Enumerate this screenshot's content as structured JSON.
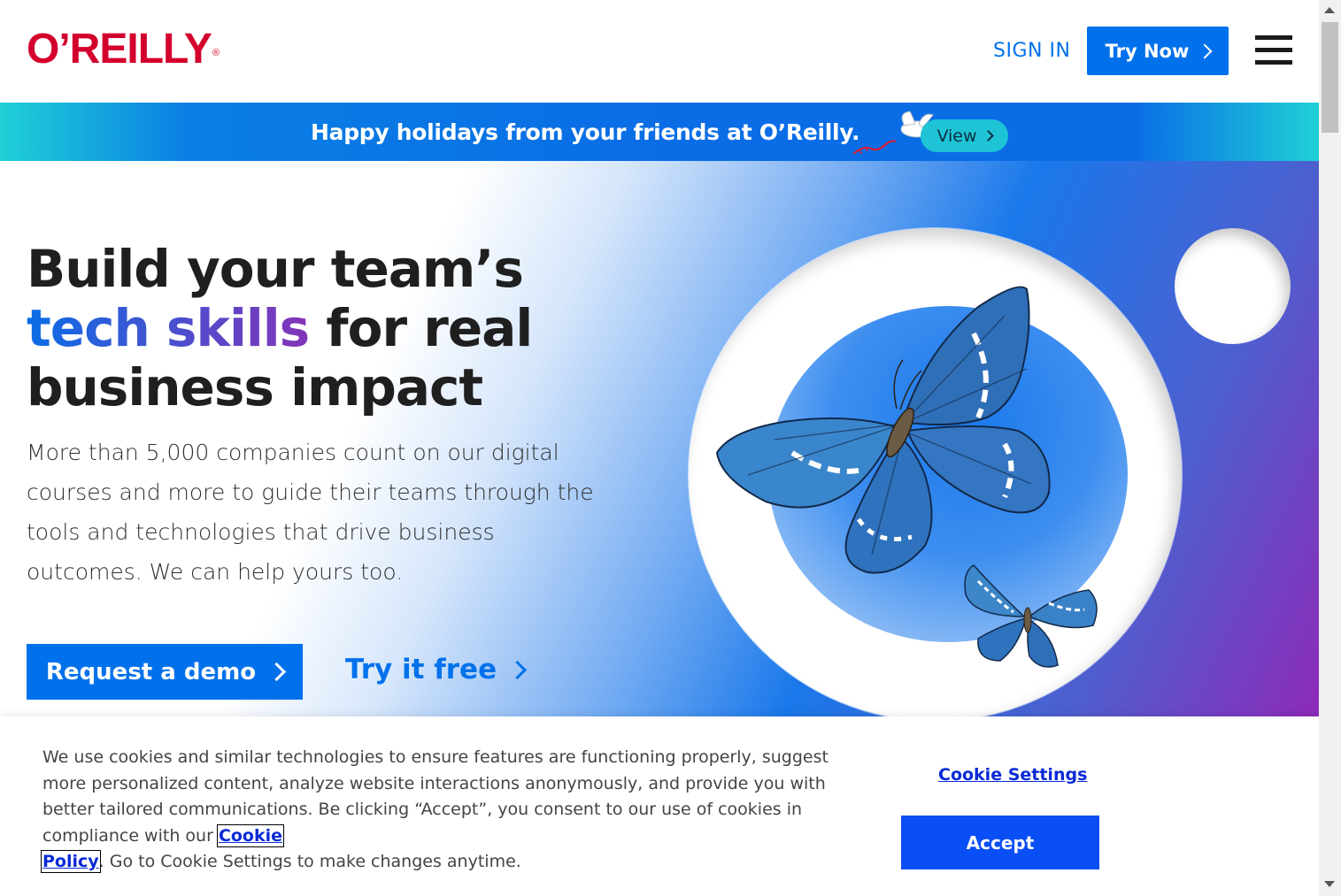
{
  "header": {
    "logo_text": "O’REILLY",
    "logo_mark": "®",
    "sign_in_label": "SIGN IN",
    "try_now_label": "Try Now",
    "menu_icon": "hamburger-icon"
  },
  "banner": {
    "text": "Happy holidays from your friends at O’Reilly.",
    "view_label": "View"
  },
  "hero": {
    "headline_line1": "Build your team’s",
    "headline_highlight": "tech skills",
    "headline_line2_rest": " for real",
    "headline_line3": "business impact",
    "subtext": "More than 5,000 companies count on our digital courses and more to guide their teams through the tools and technologies that drive business outcomes. We can help yours too.",
    "demo_label": "Request a demo",
    "try_free_label": "Try it free"
  },
  "cookie": {
    "text_before": "We use cookies and similar technologies to ensure features are functioning properly, suggest more personalized content, analyze website interactions anonymously, and provide you with better tailored communications. Be clicking “Accept”, you consent to our use of cookies in compliance with our ",
    "policy_link_part1": "Cookie",
    "policy_link_part2": "Policy",
    "text_after": ". Go to Cookie Settings to make changes anytime.",
    "settings_label": "Cookie Settings",
    "accept_label": "Accept"
  },
  "colors": {
    "brand_red": "#d3002d",
    "accent_blue": "#0071eb",
    "accept_blue": "#0a4ef5",
    "banner_teal": "#1ec4d6"
  }
}
